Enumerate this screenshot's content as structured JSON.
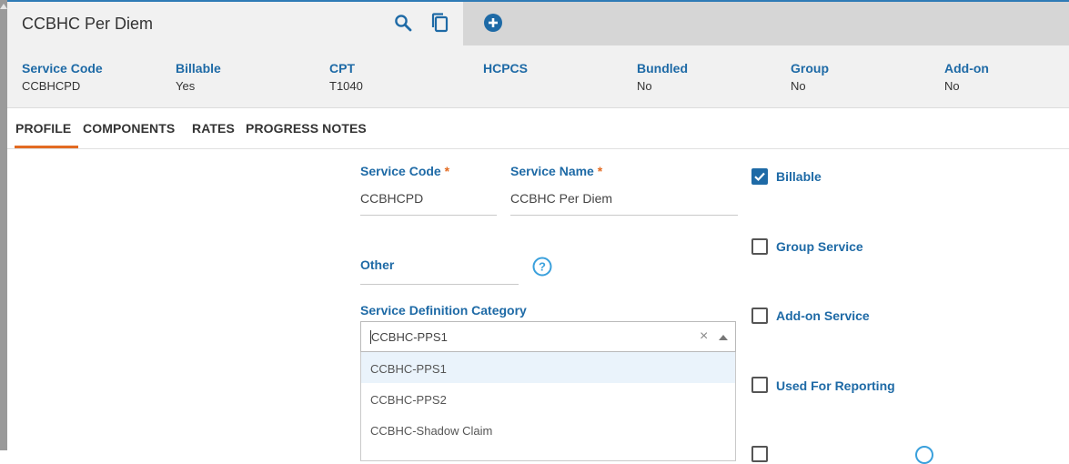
{
  "header": {
    "title": "CCBHC Per Diem",
    "icons": [
      "search-icon",
      "copy-icon",
      "add-circle-icon"
    ]
  },
  "summary": [
    {
      "label": "Service Code",
      "value": "CCBHCPD"
    },
    {
      "label": "Billable",
      "value": "Yes"
    },
    {
      "label": "CPT",
      "value": "T1040"
    },
    {
      "label": "HCPCS",
      "value": ""
    },
    {
      "label": "Bundled",
      "value": "No"
    },
    {
      "label": "Group",
      "value": "No"
    },
    {
      "label": "Add-on",
      "value": "No"
    }
  ],
  "tabs": [
    {
      "label": "PROFILE",
      "active": true
    },
    {
      "label": "COMPONENTS",
      "active": false
    },
    {
      "label": "RATES",
      "active": false
    },
    {
      "label": "PROGRESS NOTES",
      "active": false
    }
  ],
  "form": {
    "service_code": {
      "label": "Service Code",
      "required": "*",
      "value": "CCBHCPD"
    },
    "service_name": {
      "label": "Service Name",
      "required": "*",
      "value": "CCBHC Per Diem"
    },
    "other": {
      "label": "Other",
      "value": ""
    },
    "category": {
      "label": "Service Definition Category",
      "value": "CCBHC-PPS1",
      "clear_glyph": "×",
      "options": [
        "CCBHC-PPS1",
        "CCBHC-PPS2",
        "CCBHC-Shadow Claim"
      ],
      "highlighted_index": 0
    }
  },
  "checkboxes": [
    {
      "label": "Billable",
      "checked": true
    },
    {
      "label": "Group Service",
      "checked": false
    },
    {
      "label": "Add-on Service",
      "checked": false
    },
    {
      "label": "Used For Reporting",
      "checked": false
    }
  ],
  "colors": {
    "accent": "#1e6aa6",
    "tab_underline": "#e36b22",
    "required": "#e36b22",
    "help": "#3aa0dc"
  }
}
